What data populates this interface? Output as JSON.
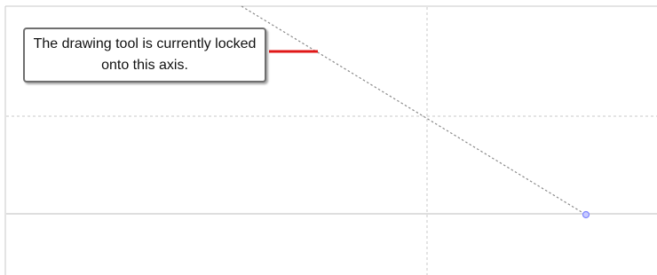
{
  "callout": {
    "text": "The drawing tool is currently locked onto this axis."
  },
  "colors": {
    "background": "#ffffff",
    "frame": "#c8c8c8",
    "grid": "#dcdcdc",
    "axis": "#bdbdbd",
    "guide": "#8a8a8a",
    "highlight": "#e01717",
    "point": "#7f86ff",
    "callout_border": "#6f6f6f"
  },
  "canvas": {
    "elements": [
      "frame-border",
      "horizontal-axis-line",
      "dotted-grid-lines",
      "diagonal-lock-guide",
      "anchor-point-icon",
      "highlight-marker"
    ]
  }
}
